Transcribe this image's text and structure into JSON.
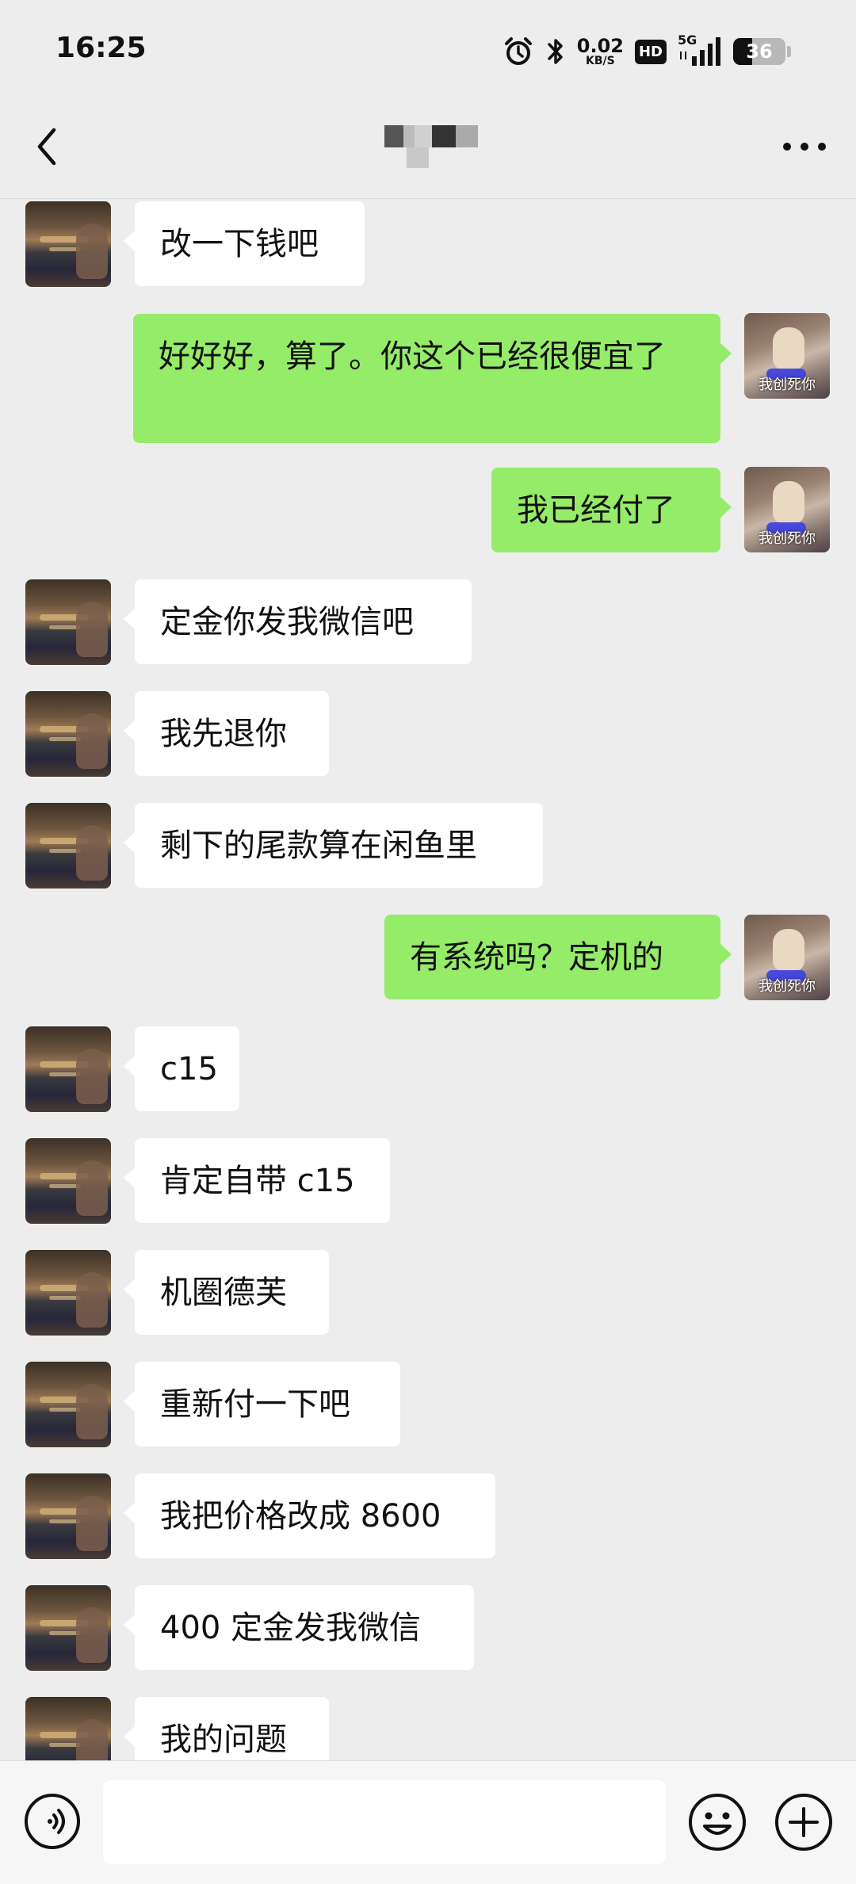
{
  "status_bar": {
    "time": "16:25",
    "net_speed_value": "0.02",
    "net_speed_unit": "KB/S",
    "hd_badge": "HD",
    "network_type": "5G",
    "battery_level": "36",
    "battery_fraction": 0.36,
    "icons": [
      "alarm-icon",
      "bluetooth-icon",
      "signal-icon",
      "battery-icon"
    ]
  },
  "nav_bar": {
    "back_icon": "chevron-left-icon",
    "more_icon": "more-dots-icon"
  },
  "colors": {
    "background": "#ededed",
    "bubble_self": "#95ec69",
    "bubble_other": "#ffffff",
    "text": "#111111"
  },
  "self_avatar_caption": "我创死你",
  "messages": [
    {
      "side": "other",
      "text": "改一下钱吧"
    },
    {
      "side": "self",
      "text": "好好好，算了。你这个已经很便宜了"
    },
    {
      "side": "self",
      "text": "我已经付了"
    },
    {
      "side": "other",
      "text": "定金你发我微信吧"
    },
    {
      "side": "other",
      "text": "我先退你"
    },
    {
      "side": "other",
      "text": "剩下的尾款算在闲鱼里"
    },
    {
      "side": "self",
      "text": "有系统吗？定机的"
    },
    {
      "side": "other",
      "text": "c15"
    },
    {
      "side": "other",
      "text": "肯定自带 c15"
    },
    {
      "side": "other",
      "text": "机圈德芙"
    },
    {
      "side": "other",
      "text": "重新付一下吧"
    },
    {
      "side": "other",
      "text": "我把价格改成 8600"
    },
    {
      "side": "other",
      "text": "400 定金发我微信"
    },
    {
      "side": "other",
      "text": "我的问题"
    }
  ],
  "input_bar": {
    "voice_icon": "voice-icon",
    "input_value": "",
    "emoji_icon": "emoji-icon",
    "plus_icon": "plus-icon"
  }
}
